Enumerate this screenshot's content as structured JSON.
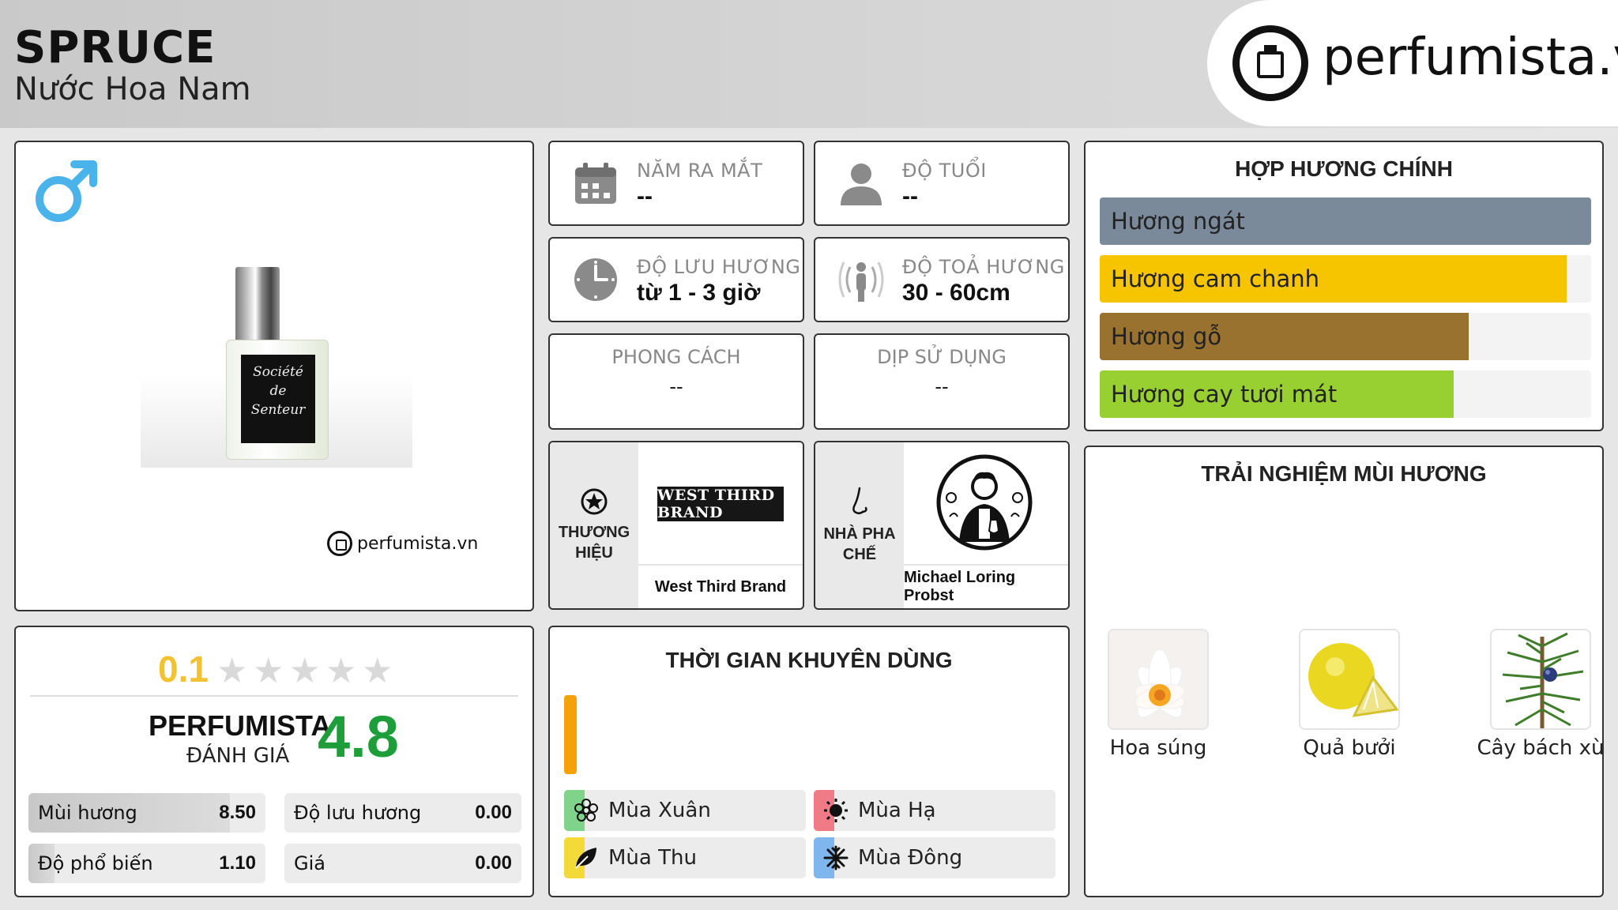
{
  "header": {
    "product_name": "SPRUCE",
    "category": "Nước Hoa Nam",
    "site_logo_text": "perfumista.vn"
  },
  "product_card": {
    "gender_icon": "male-symbol-icon",
    "watermark_text": "perfumista.vn",
    "bottle_label_lines": [
      "Société",
      "de",
      "Senteur"
    ]
  },
  "info": {
    "launch_year": {
      "label": "NĂM RA MẮT",
      "value": "--",
      "icon": "calendar-icon"
    },
    "age": {
      "label": "ĐỘ TUỔI",
      "value": "--",
      "icon": "person-icon"
    },
    "longevity": {
      "label": "ĐỘ LƯU HƯƠNG",
      "value": "từ 1 - 3 giờ",
      "icon": "clock-icon"
    },
    "sillage": {
      "label": "ĐỘ TOẢ HƯƠNG",
      "value": "30 - 60cm",
      "icon": "radiating-person-icon"
    },
    "style": {
      "label": "PHONG CÁCH",
      "value": "--"
    },
    "occasion": {
      "label": "DỊP SỬ DỤNG",
      "value": "--"
    }
  },
  "brand": {
    "label_line1": "THƯƠNG",
    "label_line2": "HIỆU",
    "logo_text": "WEST THIRD BRAND",
    "name": "West Third Brand",
    "icon": "star-badge-icon"
  },
  "perfumer": {
    "label_line1": "NHÀ PHA",
    "label_line2": "CHẾ",
    "name": "Michael Loring Probst",
    "icon": "nose-icon"
  },
  "accords": {
    "title": "HỢP HƯƠNG CHÍNH",
    "items": [
      {
        "label": "Hương ngát",
        "fraction": 1.0,
        "color": "#7b8a9a"
      },
      {
        "label": "Hương cam chanh",
        "fraction": 0.95,
        "color": "#f7c500"
      },
      {
        "label": "Hương gỗ",
        "fraction": 0.75,
        "color": "#9a7230"
      },
      {
        "label": "Hương cay tươi mát",
        "fraction": 0.72,
        "color": "#98d032"
      }
    ]
  },
  "notes": {
    "title": "TRẢI NGHIỆM MÙI HƯƠNG",
    "items": [
      {
        "name": "Hoa súng",
        "icon": "water-lily-icon"
      },
      {
        "name": "Quả bưởi",
        "icon": "pomelo-icon"
      },
      {
        "name": "Cây bách xù",
        "icon": "juniper-icon"
      }
    ]
  },
  "rating": {
    "user_score": "0.1",
    "stars_max": 5,
    "stars_filled_fraction": 0.02,
    "perfumista_label": "PERFUMISTA",
    "perfumista_sub": "ĐÁNH GIÁ",
    "perfumista_score": "4.8",
    "stats": [
      {
        "label": "Mùi hương",
        "value": "8.50",
        "fraction": 0.85
      },
      {
        "label": "Độ lưu hương",
        "value": "0.00",
        "fraction": 0.0
      },
      {
        "label": "Độ phổ biến",
        "value": "1.10",
        "fraction": 0.11
      },
      {
        "label": "Giá",
        "value": "0.00",
        "fraction": 0.0
      }
    ]
  },
  "time": {
    "title": "THỜI GIAN KHUYÊN DÙNG",
    "day_night_color": "#f5a10a",
    "seasons": [
      {
        "label": "Mùa Xuân",
        "color": "#7fd38a",
        "icon": "flower-icon"
      },
      {
        "label": "Mùa Hạ",
        "color": "#f07a86",
        "icon": "sun-icon"
      },
      {
        "label": "Mùa Thu",
        "color": "#f3da39",
        "icon": "leaf-icon"
      },
      {
        "label": "Mùa Đông",
        "color": "#7fb6ee",
        "icon": "snowflake-icon"
      }
    ]
  },
  "colors": {
    "accent_blue": "#4ab3ea",
    "score_green": "#1e9e3a",
    "star_yellow": "#f2c230"
  }
}
